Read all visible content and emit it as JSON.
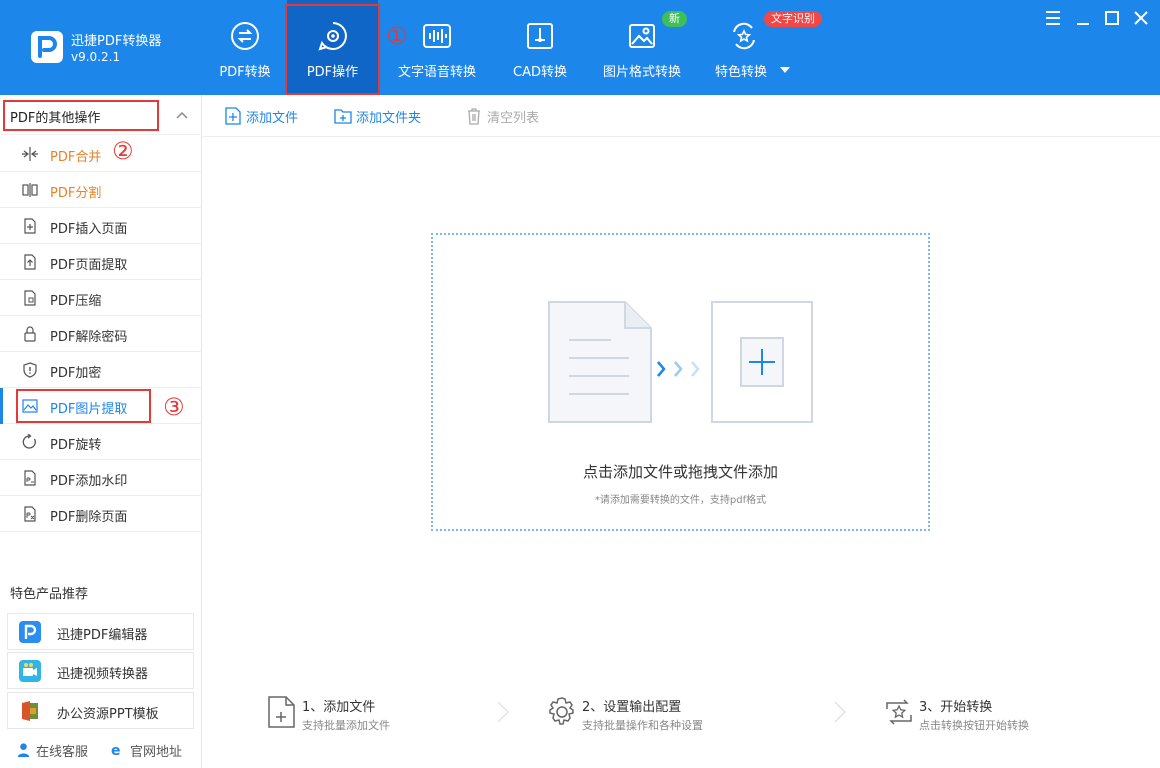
{
  "app": {
    "name": "迅捷PDF转换器",
    "version": "v9.0.2.1"
  },
  "nav": {
    "tabs": [
      {
        "label": "PDF转换",
        "icon": "convert-icon"
      },
      {
        "label": "PDF操作",
        "icon": "gear-doc-icon",
        "active": true
      },
      {
        "label": "文字语音转换",
        "icon": "audio-wave-icon"
      },
      {
        "label": "CAD转换",
        "icon": "cad-icon"
      },
      {
        "label": "图片格式转换",
        "icon": "image-icon",
        "badge": "新"
      },
      {
        "label": "特色转换",
        "icon": "star-convert-icon",
        "badge": "文字识别",
        "dropdown": true
      }
    ]
  },
  "annotations": {
    "one": "①",
    "two": "②",
    "three": "③"
  },
  "sidebar": {
    "header": "PDF的其他操作",
    "items": [
      {
        "label": "PDF合并",
        "icon": "merge-icon"
      },
      {
        "label": "PDF分割",
        "icon": "split-icon"
      },
      {
        "label": "PDF插入页面",
        "icon": "insert-page-icon"
      },
      {
        "label": "PDF页面提取",
        "icon": "extract-page-icon"
      },
      {
        "label": "PDF压缩",
        "icon": "compress-icon"
      },
      {
        "label": "PDF解除密码",
        "icon": "unlock-icon"
      },
      {
        "label": "PDF加密",
        "icon": "shield-icon"
      },
      {
        "label": "PDF图片提取",
        "icon": "image-extract-icon"
      },
      {
        "label": "PDF旋转",
        "icon": "rotate-icon"
      },
      {
        "label": "PDF添加水印",
        "icon": "watermark-icon"
      },
      {
        "label": "PDF删除页面",
        "icon": "delete-page-icon"
      }
    ],
    "promo_title": "特色产品推荐",
    "promos": [
      {
        "label": "迅捷PDF编辑器"
      },
      {
        "label": "迅捷视频转换器"
      },
      {
        "label": "办公资源PPT模板"
      }
    ],
    "footer": {
      "service": "在线客服",
      "website": "官网地址"
    }
  },
  "toolbar": {
    "add_file": "添加文件",
    "add_folder": "添加文件夹",
    "clear_list": "清空列表"
  },
  "dropzone": {
    "title": "点击添加文件或拖拽文件添加",
    "subtitle": "*请添加需要转换的文件，支持pdf格式"
  },
  "steps": [
    {
      "title": "1、添加文件",
      "desc": "支持批量添加文件"
    },
    {
      "title": "2、设置输出配置",
      "desc": "支持批量操作和各种设置"
    },
    {
      "title": "3、开始转换",
      "desc": "点击转换按钮开始转换"
    }
  ],
  "colors": {
    "primary": "#1d86ea",
    "active_tab": "#1066c6",
    "annotation": "#e53935",
    "orange": "#e8822b"
  }
}
